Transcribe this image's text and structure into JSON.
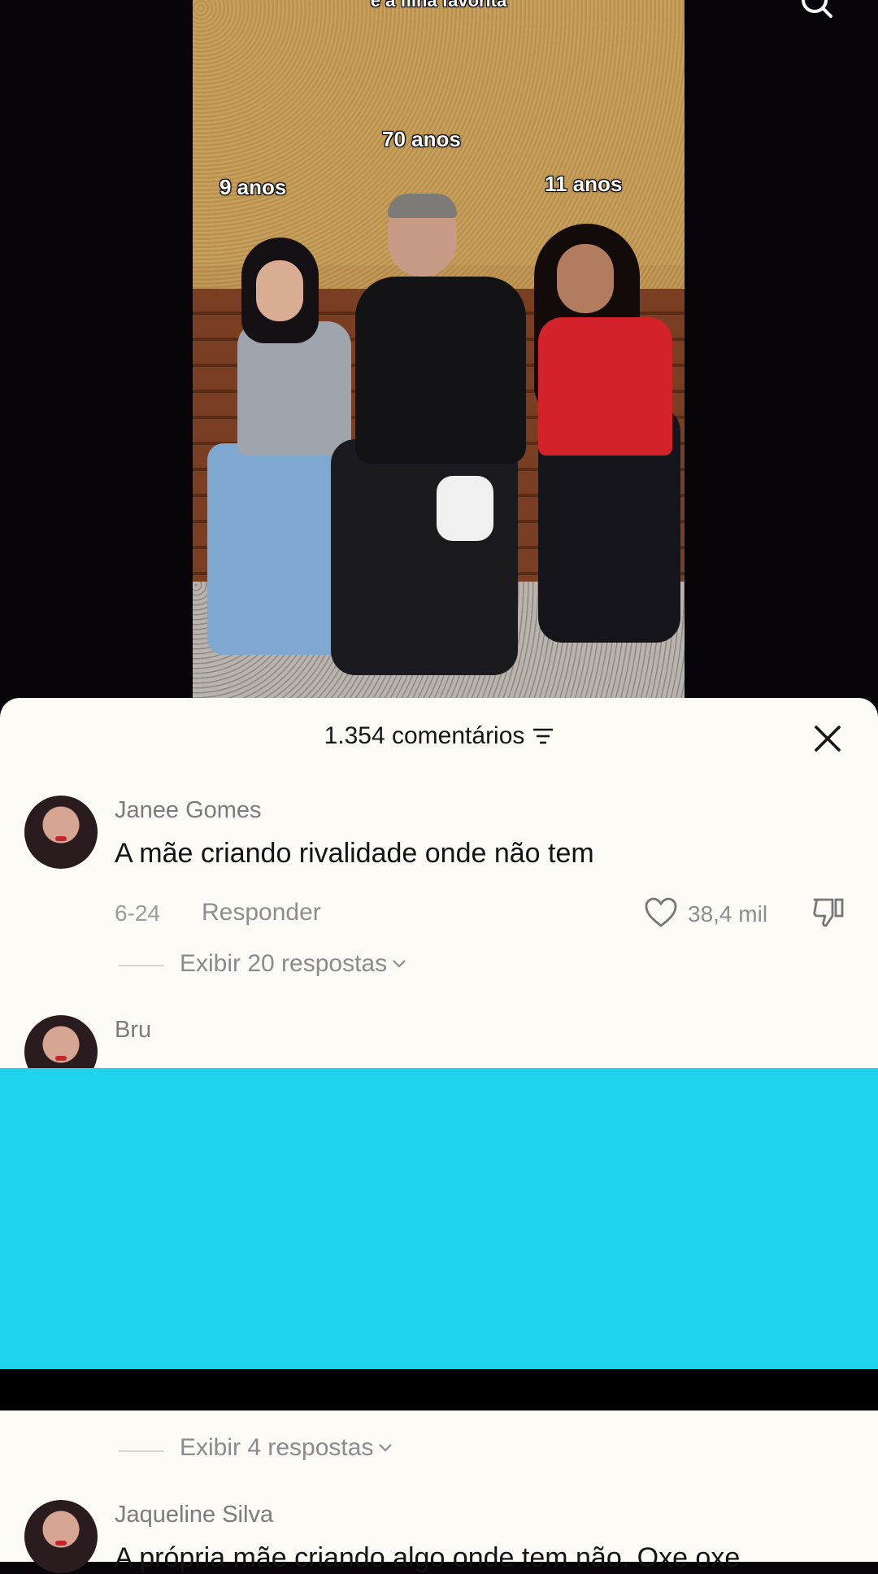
{
  "video": {
    "caption_top": "e a filha favorita",
    "label_center": "70 anos",
    "label_left": "9 anos",
    "label_right": "11 anos"
  },
  "comments_sheet": {
    "title": "1.354 comentários",
    "comments": [
      {
        "username": "Janee Gomes",
        "text": "A mãe criando rivalidade onde não tem",
        "date": "6-24",
        "reply_label": "Responder",
        "likes": "38,4 mil",
        "view_replies": "Exibir 20 respostas"
      },
      {
        "username": "Bru",
        "text": "",
        "date": "",
        "reply_label": "",
        "likes": "",
        "view_replies": "Exibir 4 respostas"
      },
      {
        "username": "Jaqueline Silva",
        "text": "A própria mãe criando algo onde tem não. Oxe oxe",
        "date": "",
        "reply_label": "",
        "likes": "",
        "view_replies": ""
      }
    ]
  },
  "icons": {
    "search": "search-icon",
    "close": "close-icon",
    "sort": "sort-icon",
    "like": "heart-icon",
    "dislike": "thumbs-down-icon",
    "chevron": "chevron-down-icon"
  },
  "colors": {
    "redaction": "#20d3ec",
    "sheet_bg": "#fbfaf5"
  }
}
